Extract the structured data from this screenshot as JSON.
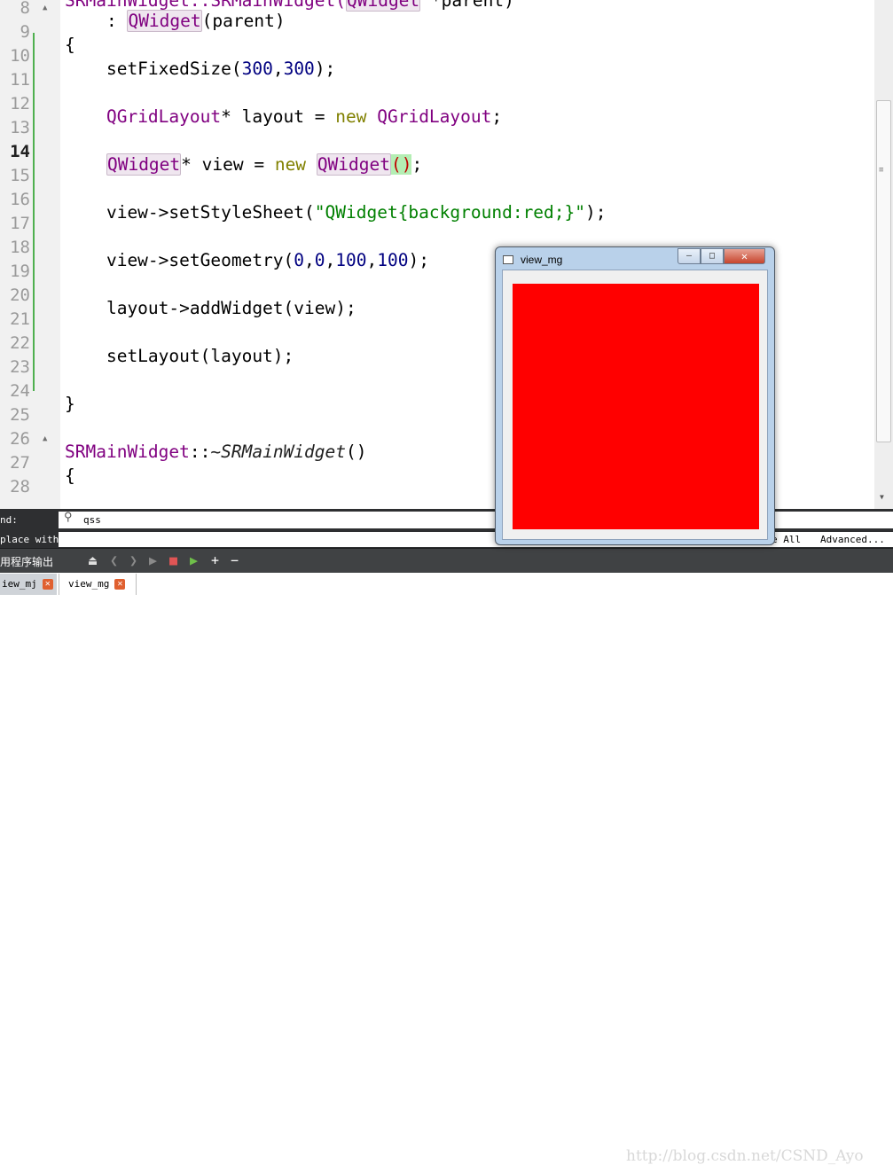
{
  "editor": {
    "lines": [
      {
        "num": "8"
      },
      {
        "num": "9"
      },
      {
        "num": "10"
      },
      {
        "num": "11"
      },
      {
        "num": "12"
      },
      {
        "num": "13"
      },
      {
        "num": "14"
      },
      {
        "num": "15"
      },
      {
        "num": "16"
      },
      {
        "num": "17"
      },
      {
        "num": "18"
      },
      {
        "num": "19"
      },
      {
        "num": "20"
      },
      {
        "num": "21"
      },
      {
        "num": "22"
      },
      {
        "num": "23"
      },
      {
        "num": "24"
      },
      {
        "num": "25"
      },
      {
        "num": "26"
      },
      {
        "num": "27"
      },
      {
        "num": "28"
      }
    ],
    "current_line": "14",
    "code": {
      "l7_a": "SRMainWidget::SRMainWidget(",
      "l7_b": "QWidget",
      "l7_c": " *parent)",
      "l8_a": "    : ",
      "l8_b": "QWidget",
      "l8_c": "(parent)",
      "l9": "{",
      "l10_a": "    setFixedSize(",
      "l10_b": "300",
      "l10_c": ",",
      "l10_d": "300",
      "l10_e": ");",
      "l12_a": "    ",
      "l12_b": "QGridLayout",
      "l12_c": "* layout = ",
      "l12_d": "new",
      "l12_e": " ",
      "l12_f": "QGridLayout",
      "l12_g": ";",
      "l14_a": "    ",
      "l14_b": "QWidget",
      "l14_c": "* view = ",
      "l14_d": "new",
      "l14_e": " ",
      "l14_f": "QWidget",
      "l14_g": "()",
      "l14_h": ";",
      "l16_a": "    view->setStyleSheet(",
      "l16_b": "\"QWidget{background:red;}\"",
      "l16_c": ");",
      "l18_a": "    view->setGeometry(",
      "l18_b": "0",
      "l18_c": ",",
      "l18_d": "0",
      "l18_e": ",",
      "l18_f": "100",
      "l18_g": ",",
      "l18_h": "100",
      "l18_i": ");",
      "l20": "    layout->addWidget(view);",
      "l22": "    setLayout(layout);",
      "l24": "}",
      "l26_a": "SRMainWidget",
      "l26_b": "::",
      "l26_c": "~SRMainWidget",
      "l26_d": "()",
      "l27": "{"
    }
  },
  "find": {
    "find_label": "nd:",
    "replace_label": "place with:",
    "query": "qss",
    "replace_all": "e All",
    "advanced": "Advanced...",
    "close": "✕"
  },
  "output": {
    "title": "用程序输出",
    "tabs": [
      {
        "label": "iew_mj",
        "close": "✕"
      },
      {
        "label": "view_mg",
        "close": "✕"
      }
    ]
  },
  "window": {
    "title": "view_mg",
    "minimize": "—",
    "maximize": "□",
    "close": "✕",
    "view_color": "#ff0000"
  },
  "watermark": "http://blog.csdn.net/CSND_Ayo",
  "colors": {
    "type": "#800080",
    "keyword": "#808000",
    "number": "#000080",
    "string": "#008000",
    "changebar": "#4fb04f"
  }
}
